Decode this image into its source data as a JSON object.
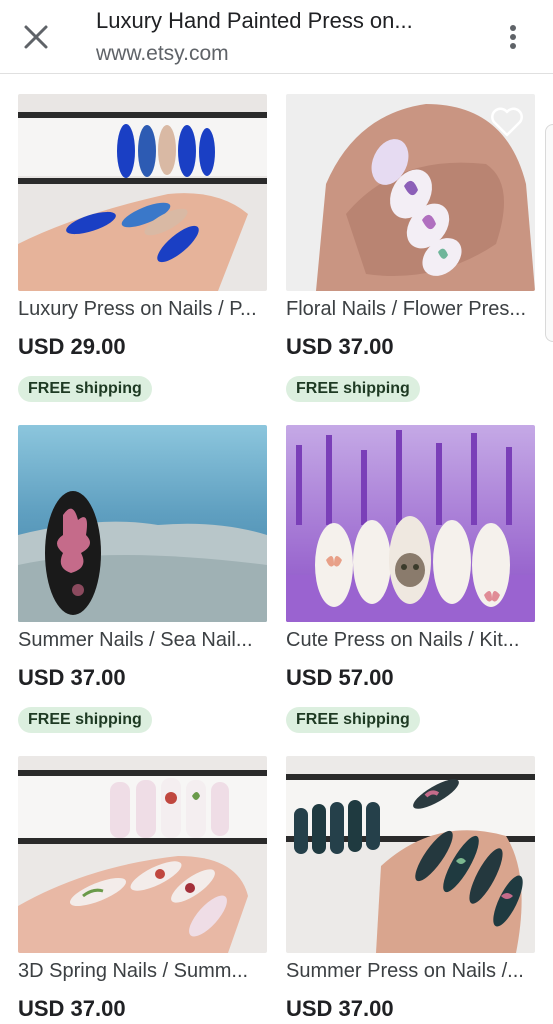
{
  "header": {
    "title": "Luxury Hand Painted Press on...",
    "url": "www.etsy.com",
    "close_icon": "close-icon",
    "menu_icon": "more-vert-icon"
  },
  "products": [
    {
      "title": "Luxury Press on Nails / P...",
      "price": "USD 29.00",
      "shipping": "FREE shipping"
    },
    {
      "title": "Floral Nails / Flower Pres...",
      "price": "USD 37.00",
      "shipping": "FREE shipping"
    },
    {
      "title": "Summer Nails / Sea Nail...",
      "price": "USD 37.00",
      "shipping": "FREE shipping"
    },
    {
      "title": "Cute Press on Nails / Kit...",
      "price": "USD 57.00",
      "shipping": "FREE shipping"
    },
    {
      "title": "3D Spring Nails / Summ...",
      "price": "USD 37.00"
    },
    {
      "title": "Summer Press on Nails /...",
      "price": "USD 37.00"
    }
  ],
  "colors": {
    "badge_bg": "#dcefdf",
    "badge_text": "#1e3a23"
  }
}
